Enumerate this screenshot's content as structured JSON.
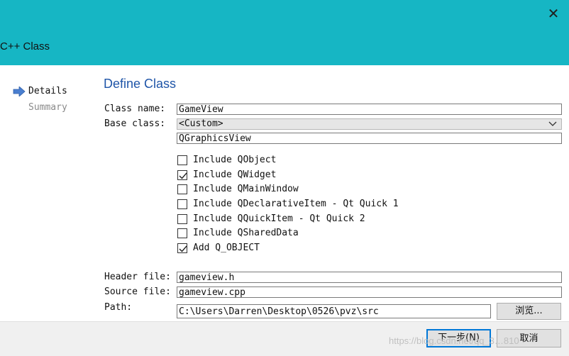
{
  "window": {
    "title": "C++ Class",
    "close_glyph": "✕"
  },
  "steps": [
    {
      "label": "Details",
      "active": true
    },
    {
      "label": "Summary",
      "active": false
    }
  ],
  "form": {
    "heading": "Define Class",
    "class_name_label": "Class name:",
    "class_name_value": "GameView",
    "base_class_label": "Base class:",
    "base_class_selected": "<Custom>",
    "base_class_custom": "QGraphicsView",
    "checkboxes": [
      {
        "label": "Include QObject",
        "checked": false
      },
      {
        "label": "Include QWidget",
        "checked": true
      },
      {
        "label": "Include QMainWindow",
        "checked": false
      },
      {
        "label": "Include QDeclarativeItem - Qt Quick 1",
        "checked": false
      },
      {
        "label": "Include QQuickItem - Qt Quick 2",
        "checked": false
      },
      {
        "label": "Include QSharedData",
        "checked": false
      },
      {
        "label": "Add Q_OBJECT",
        "checked": true
      }
    ],
    "header_file_label": "Header file:",
    "header_file_value": "gameview.h",
    "source_file_label": "Source file:",
    "source_file_value": "gameview.cpp",
    "path_label": "Path:",
    "path_value": "C:\\Users\\Darren\\Desktop\\0526\\pvz\\src",
    "browse_label": "浏览..."
  },
  "footer": {
    "next_label": "下一步(N)",
    "cancel_label": "取消",
    "watermark": "https://blog.csdn.net/qq_3…810"
  },
  "colors": {
    "titlebar": "#16b6c4",
    "heading": "#1f55a8",
    "primary_border": "#0078d7",
    "arrow": "#4a7fd0"
  }
}
